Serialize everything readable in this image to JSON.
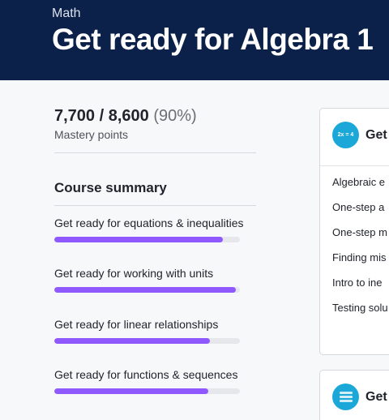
{
  "header": {
    "subject": "Math",
    "title": "Get ready for Algebra 1",
    "background": "#0b2149"
  },
  "mastery": {
    "value": "7,700 / 8,600",
    "percent": "(90%)",
    "label": "Mastery points"
  },
  "summary": {
    "title": "Course summary",
    "accent": "#9059ff",
    "units": [
      {
        "label": "Get ready for equations & inequalities",
        "progress": 0.91
      },
      {
        "label": "Get ready for working with units",
        "progress": 0.98
      },
      {
        "label": "Get ready for linear relationships",
        "progress": 0.84
      },
      {
        "label": "Get ready for functions & sequences",
        "progress": 0.83
      }
    ]
  },
  "cards": [
    {
      "icon": "2x-equals-4-icon",
      "icon_text": "2x = 4",
      "title": "Get",
      "lessons": [
        "Algebraic e",
        "One-step a",
        "One-step m",
        "Finding mis",
        "Intro to ine",
        "Testing solu"
      ]
    },
    {
      "icon": "unit-bars-icon",
      "title": "Get",
      "lessons": []
    }
  ]
}
